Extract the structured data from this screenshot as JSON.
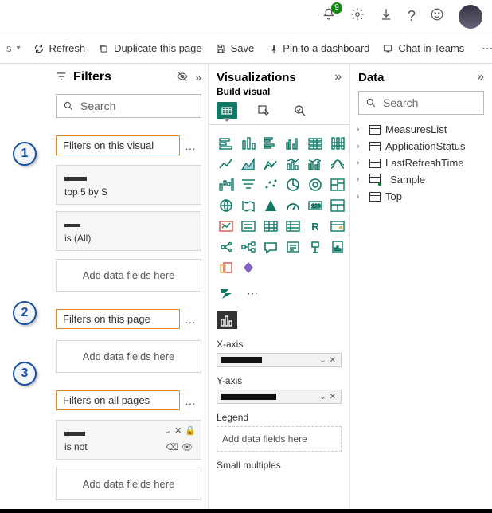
{
  "topbar": {
    "notification_count": "9"
  },
  "toolbar": {
    "refresh": "Refresh",
    "duplicate": "Duplicate this page",
    "save": "Save",
    "pin": "Pin to a dashboard",
    "chat": "Chat in Teams"
  },
  "filters": {
    "title": "Filters",
    "search_placeholder": "Search",
    "sections": {
      "visual": "Filters on this visual",
      "page": "Filters on this page",
      "all": "Filters on all pages"
    },
    "visual_cards": {
      "card1_sub": "top 5 by S",
      "card2_sub": "is (All)"
    },
    "all_card_sub": "is not",
    "add_fields": "Add data fields here"
  },
  "viz": {
    "title": "Visualizations",
    "subtitle": "Build visual",
    "xaxis": "X-axis",
    "yaxis": "Y-axis",
    "legend": "Legend",
    "small_mult": "Small multiples",
    "add_fields": "Add data fields here"
  },
  "data": {
    "title": "Data",
    "search_placeholder": "Search",
    "fields": [
      {
        "name": "MeasuresList",
        "kind": "table"
      },
      {
        "name": "ApplicationStatus",
        "kind": "table"
      },
      {
        "name": "LastRefreshTime",
        "kind": "table"
      },
      {
        "name": "Sample",
        "kind": "table-check"
      },
      {
        "name": "Top",
        "kind": "table"
      }
    ]
  },
  "annotations": {
    "n1": "1",
    "n2": "2",
    "n3": "3"
  }
}
